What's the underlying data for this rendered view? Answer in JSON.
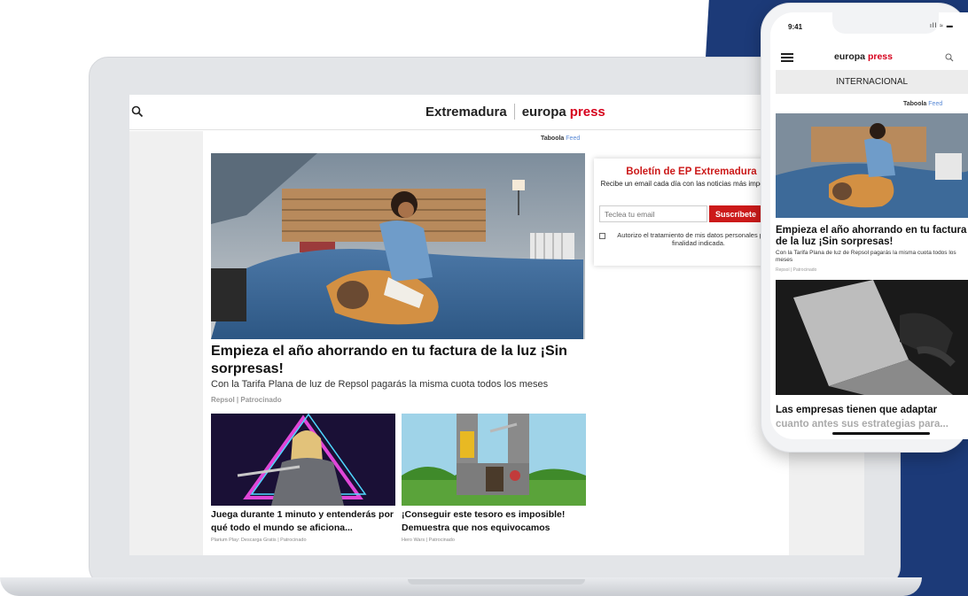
{
  "laptop": {
    "header": {
      "region": "Extremadura",
      "brand_a": "europa",
      "brand_b": "press"
    },
    "taboola": {
      "brand": "Taboola",
      "feed": "Feed"
    },
    "hero": {
      "title": "Empieza el año ahorrando en tu factura de la luz ¡Sin sorpresas!",
      "description": "Con la Tarifa Plana de luz de Repsol pagarás la misma cuota todos los meses",
      "source": "Repsol | Patrocinado"
    },
    "cards": [
      {
        "title": "Juega durante 1 minuto y entenderás por qué todo el mundo se aficiona...",
        "source": "Plarium Play: Descarga Gratis | Patrocinado"
      },
      {
        "title": "¡Conseguir este tesoro es imposible! Demuestra que nos equivocamos",
        "source": "Hero Wars | Patrocinado"
      }
    ],
    "newsletter": {
      "title": "Boletín de EP Extremadura",
      "description": "Recibe un email cada día con las noticias más importantes.",
      "email_placeholder": "Teclea tu email",
      "subscribe_label": "Suscríbete",
      "consent": "Autorizo el tratamiento de mis datos personales para la finalidad indicada."
    }
  },
  "phone": {
    "time": "9:41",
    "status": "ıll ≈ ▬",
    "brand_a": "europa",
    "brand_b": "press",
    "section": "INTERNACIONAL",
    "taboola": {
      "brand": "Taboola",
      "feed": "Feed"
    },
    "article1": {
      "title": "Empieza el año ahorrando en tu factura de la luz ¡Sin sorpresas!",
      "description": "Con la Tarifa Plana de luz de Repsol pagarás la misma cuota todos los meses",
      "source": "Repsol | Patrocinado"
    },
    "article2": {
      "title_a": "Las empresas tienen que adaptar",
      "title_b": "cuanto antes sus estrategias para..."
    }
  },
  "colors": {
    "brand_red": "#d6001c",
    "navy": "#1c3a78",
    "newsletter_red": "#cc1a1a"
  }
}
